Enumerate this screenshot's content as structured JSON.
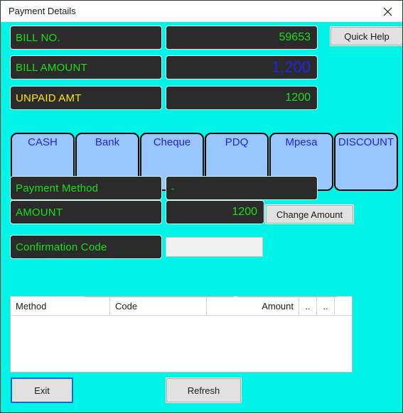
{
  "window": {
    "title": "Payment Details",
    "close_icon": "close-icon",
    "background_color": "#00f5e8"
  },
  "quick_help": {
    "label": "Quick Help"
  },
  "fields": [
    {
      "label": "BILL NO.",
      "label_color": "#19e019",
      "value": "59653",
      "value_color": "#19e019"
    },
    {
      "label": "BILL AMOUNT",
      "label_color": "#19e019",
      "value": "1,200",
      "value_color": "#2222ee"
    },
    {
      "label": "UNPAID AMT",
      "label_color": "#ffe500",
      "value": "1200",
      "value_color": "#19e019"
    }
  ],
  "payment_buttons": [
    {
      "label": "CASH"
    },
    {
      "label": "Bank"
    },
    {
      "label": "Cheque"
    },
    {
      "label": "PDQ"
    },
    {
      "label": "Mpesa"
    },
    {
      "label": "DISCOUNT"
    }
  ],
  "payment_method": {
    "label": "Payment Method",
    "value": "-"
  },
  "amount": {
    "label": "AMOUNT",
    "value": "1200",
    "change_button": "Change Amount"
  },
  "confirmation": {
    "label": "Confirmation Code",
    "value": "",
    "placeholder": ""
  },
  "table": {
    "columns": [
      "Method",
      "Code",
      "Amount",
      "..",
      ".."
    ],
    "rows": []
  },
  "footer": {
    "exit_label": "Exit",
    "refresh_label": "Refresh"
  }
}
